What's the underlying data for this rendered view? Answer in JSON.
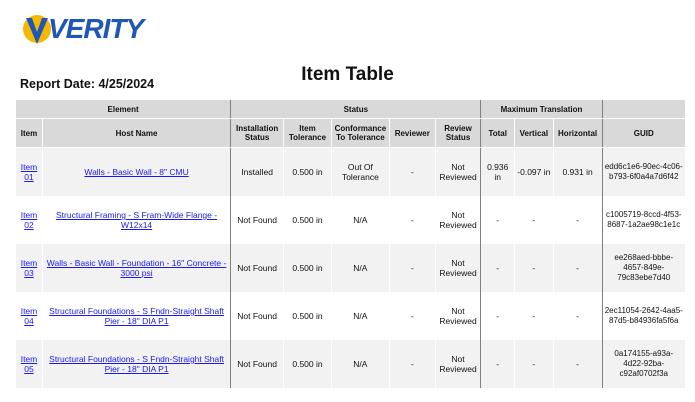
{
  "header": {
    "logo_text": "VERITY",
    "report_date": "Report Date: 4/25/2024",
    "title": "Item Table"
  },
  "table": {
    "group_headers": {
      "element": "Element",
      "status": "Status",
      "max_translation": "Maximum Translation"
    },
    "columns": {
      "item": "Item",
      "host_name": "Host Name",
      "installation_status": "Installation Status",
      "item_tolerance": "Item Tolerance",
      "conformance": "Conformance To Tolerance",
      "reviewer": "Reviewer",
      "review_status": "Review Status",
      "total": "Total",
      "vertical": "Vertical",
      "horizontal": "Horizontal",
      "guid": "GUID"
    },
    "rows": [
      {
        "item": "Item 01",
        "host_name": "Walls - Basic Wall - 8\" CMU",
        "installation_status": "Installed",
        "item_tolerance": "0.500 in",
        "conformance": "Out Of Tolerance",
        "reviewer": "-",
        "review_status": "Not Reviewed",
        "total": "0.936 in",
        "vertical": "-0.097 in",
        "horizontal": "0.931 in",
        "guid": "edd6c1e6-90ec-4c06-b793-6f0a4a7d6f42"
      },
      {
        "item": "Item 02",
        "host_name": "Structural Framing - S Fram-Wide Flange - W12x14",
        "installation_status": "Not Found",
        "item_tolerance": "0.500 in",
        "conformance": "N/A",
        "reviewer": "-",
        "review_status": "Not Reviewed",
        "total": "-",
        "vertical": "-",
        "horizontal": "-",
        "guid": "c1005719-8ccd-4f53-8687-1a2ae98c1e1c"
      },
      {
        "item": "Item 03",
        "host_name": "Walls - Basic Wall - Foundation - 16\" Concrete - 3000 psi",
        "installation_status": "Not Found",
        "item_tolerance": "0.500 in",
        "conformance": "N/A",
        "reviewer": "-",
        "review_status": "Not Reviewed",
        "total": "-",
        "vertical": "-",
        "horizontal": "-",
        "guid": "ee268aed-bbbe-4657-849e-79c83ebe7d40"
      },
      {
        "item": "Item 04",
        "host_name": "Structural Foundations - S Fndn-Straight Shaft Pier - 18\" DIA P1",
        "installation_status": "Not Found",
        "item_tolerance": "0.500 in",
        "conformance": "N/A",
        "reviewer": "-",
        "review_status": "Not Reviewed",
        "total": "-",
        "vertical": "-",
        "horizontal": "-",
        "guid": "2ec11054-2642-4aa5-87d5-b84936fa5f6a"
      },
      {
        "item": "Item 05",
        "host_name": "Structural Foundations - S Fndn-Straight Shaft Pier - 18\" DIA P1",
        "installation_status": "Not Found",
        "item_tolerance": "0.500 in",
        "conformance": "N/A",
        "reviewer": "-",
        "review_status": "Not Reviewed",
        "total": "-",
        "vertical": "-",
        "horizontal": "-",
        "guid": "0a174155-a93a-4d22-92ba-c92af0702f3a"
      }
    ]
  }
}
